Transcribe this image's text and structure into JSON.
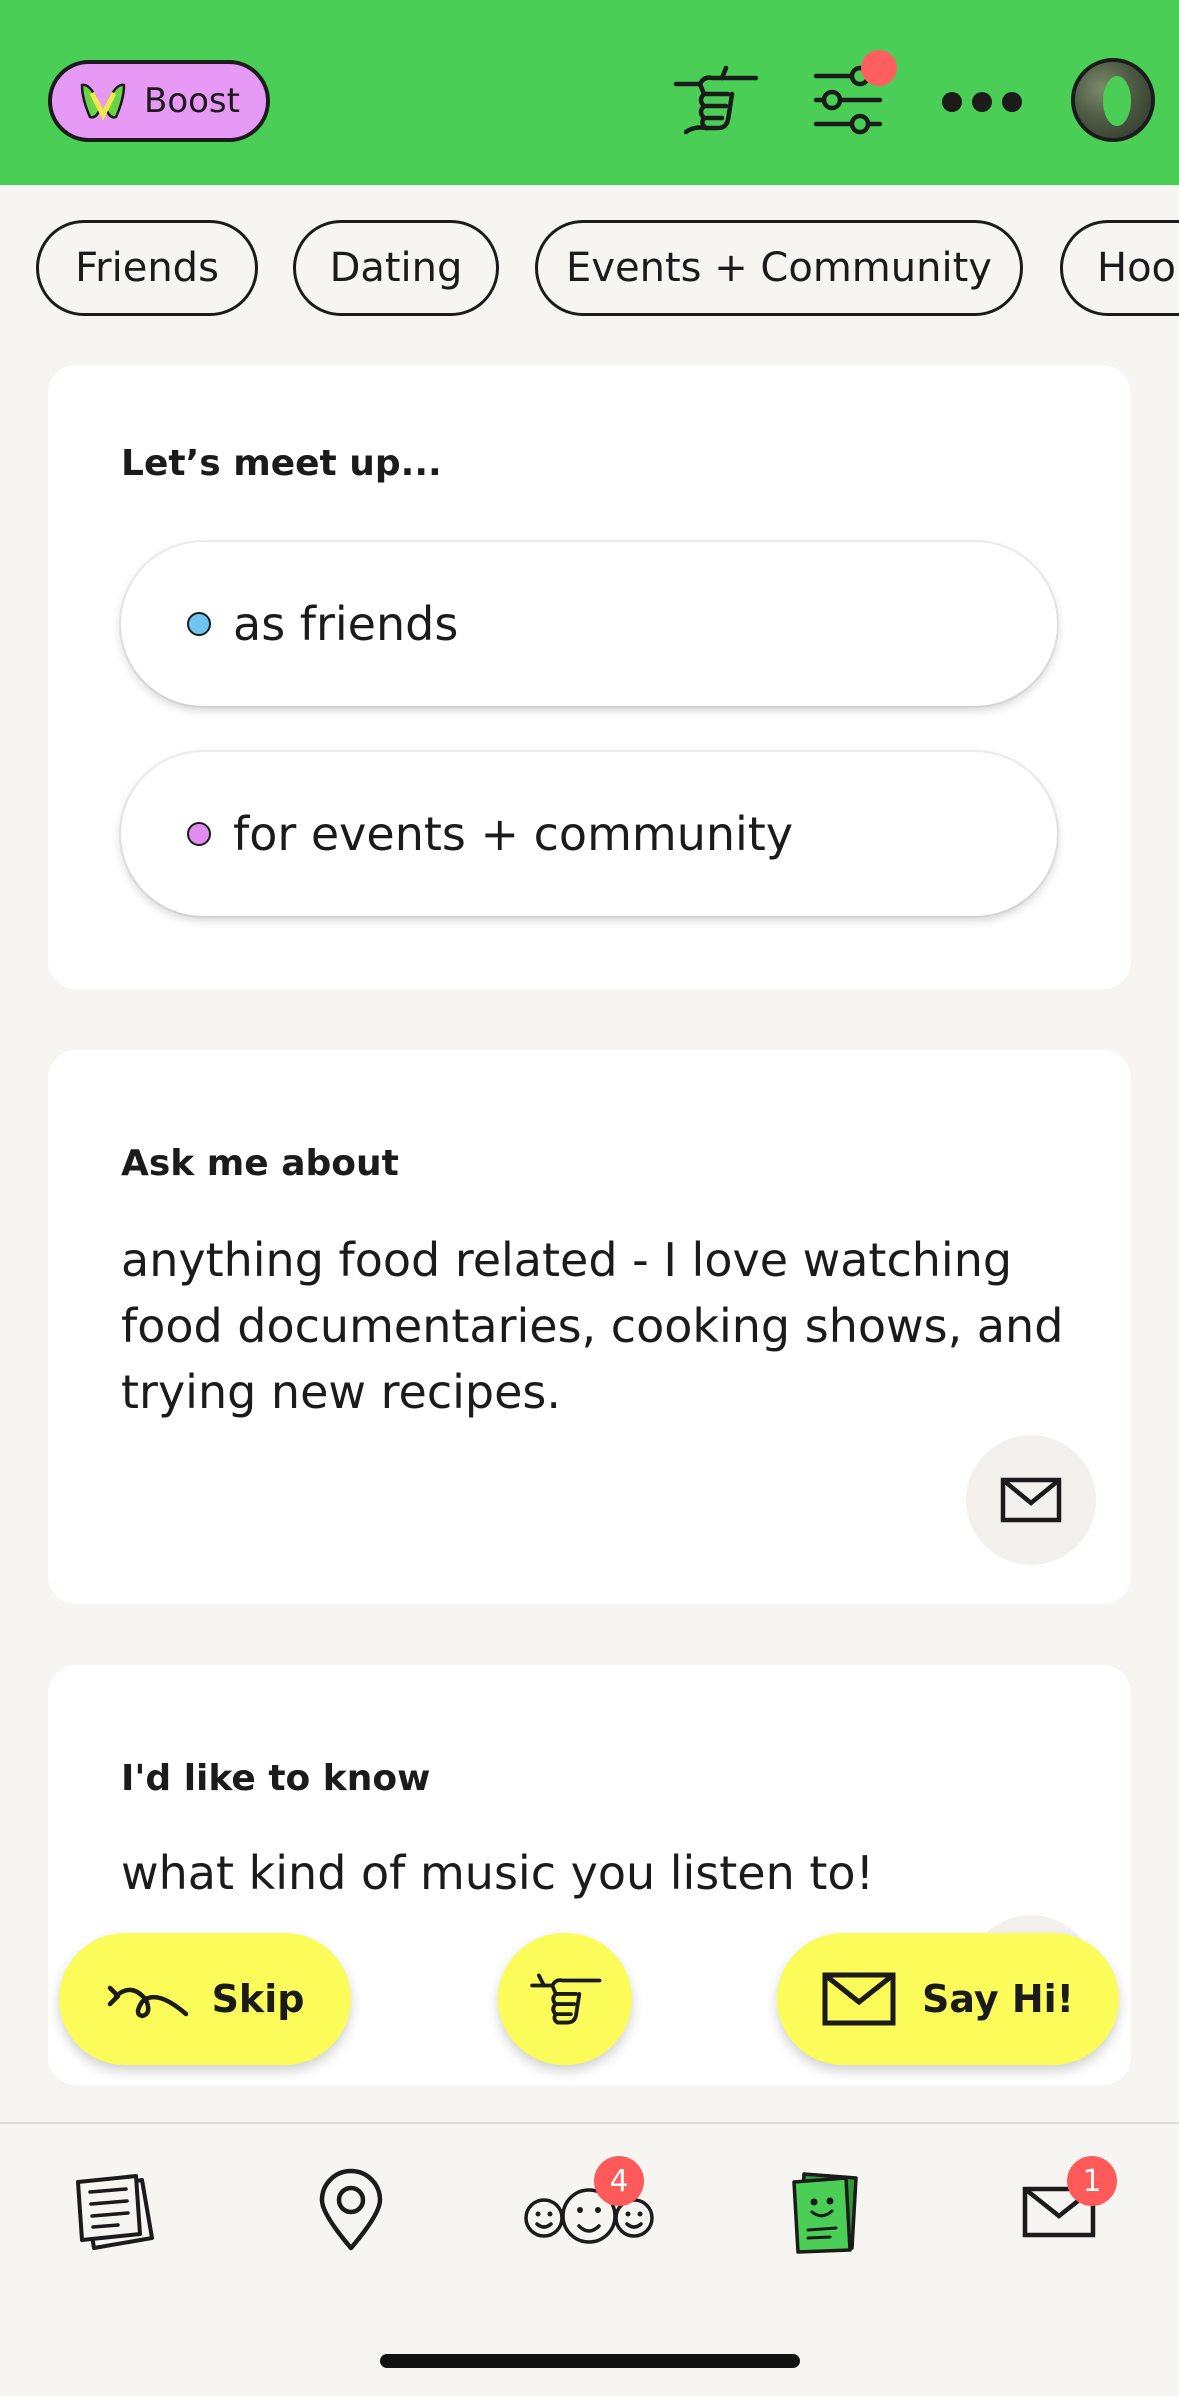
{
  "colors": {
    "header_bg": "#4ace56",
    "boost_bg": "#e79af5",
    "action_yellow": "#fbfb5a",
    "badge_red": "#ff5a5a",
    "friends_dot": "#6ec6f0",
    "events_dot": "#e08cf0"
  },
  "header": {
    "boost_label": "Boost",
    "icons": [
      "boost-logo-icon",
      "pointing-hand-icon",
      "filter-sliders-icon",
      "more-icon",
      "avatar"
    ]
  },
  "chips": [
    {
      "label": "Friends"
    },
    {
      "label": "Dating"
    },
    {
      "label": "Events + Community"
    },
    {
      "label": "Hoo"
    }
  ],
  "meet_up": {
    "title": "Let’s meet up...",
    "options": [
      {
        "label": "as friends",
        "dot": "friends"
      },
      {
        "label": "for events + community",
        "dot": "events"
      }
    ]
  },
  "ask_me": {
    "title": "Ask me about",
    "lines": [
      "anything food related - I love watching",
      "food documentaries, cooking shows, and",
      "trying new recipes."
    ]
  },
  "like_to_know": {
    "title": "I'd like to know",
    "text": "what kind of music you listen to!"
  },
  "actions": {
    "skip_label": "Skip",
    "say_hi_label": "Say Hi!"
  },
  "bottom_nav": {
    "items": [
      "feed-icon",
      "map-pin-icon",
      "people-icon",
      "profile-cards-icon",
      "inbox-icon"
    ],
    "people_badge": "4",
    "inbox_badge": "1"
  }
}
